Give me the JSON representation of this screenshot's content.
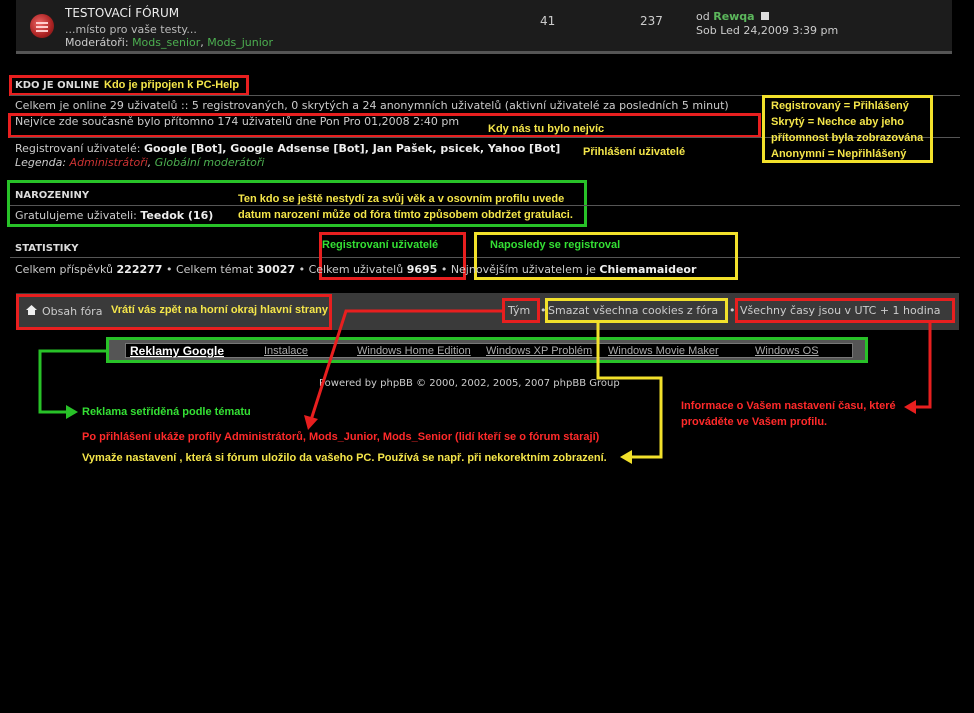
{
  "forum": {
    "title": "TESTOVACÍ FÓRUM",
    "description": "...místo pro vaše testy...",
    "moderators_label": "Moderátoři:",
    "moderator1": "Mods_senior",
    "separator": ",",
    "moderator2": "Mods_junior",
    "topics": "41",
    "posts": "237",
    "last_post_prefix": "od",
    "last_post_user": "Rewqa",
    "last_post_date": "Sob Led 24,2009 3:39 pm"
  },
  "online": {
    "header": "KDO JE ONLINE",
    "total_line": "Celkem je online 29 uživatelů :: 5 registrovaných, 0 skrytých a 24 anonymních uživatelů (aktivní uživatelé za posledních 5 minut)",
    "max_line": "Nejvíce zde současně bylo přítomno 174 uživatelů dne Pon Pro 01,2008 2:40 pm",
    "registered_prefix": "Registrovaní uživatelé:",
    "registered_users": "Google [Bot], Google Adsense [Bot], Jan Pašek, psicek, Yahoo [Bot]",
    "legend_label": "Legenda:",
    "legend_admins": "Administrátoři",
    "legend_mods": "Globální moderátoři"
  },
  "birthdays": {
    "header": "NAROZENINY",
    "line_prefix": "Gratulujeme uživateli:",
    "user": "Teedok (16)"
  },
  "stats": {
    "header": "STATISTIKY",
    "posts_label": "Celkem příspěvků",
    "posts": "222277",
    "topics_label": "Celkem témat",
    "topics": "30027",
    "users_label": "Celkem uživatelů",
    "users": "9695",
    "newest_label": "Nejnovějším uživatelem je",
    "newest": "Chiemamaideor",
    "bullet": "•"
  },
  "navbar": {
    "home": "Obsah fóra",
    "team": "Tým",
    "cookies": "Smazat všechna cookies z fóra",
    "timezone": "Všechny časy jsou v UTC + 1 hodina"
  },
  "ads": {
    "title": "Reklamy Google",
    "links": [
      "Instalace",
      "Windows Home Edition",
      "Windows XP Problém",
      "Windows Movie Maker",
      "Windows OS"
    ]
  },
  "footer": "Powered by phpBB © 2000, 2002, 2005, 2007 phpBB Group",
  "notes": {
    "online": "Kdo je připojen k PC-Help",
    "legend_l1": "Registrovaný = Přihlášený",
    "legend_l2": "Skrytý = Nechce aby jeho",
    "legend_l3": "přítomnost byla zobrazována",
    "legend_l4": "Anonymní = Nepřihlášený",
    "max": "Kdy nás tu bylo nejvíc",
    "logged": "Přihlášení uživatelé",
    "birthday_l1": "Ten kdo se ještě nestydí za svůj věk a v osovním profilu uvede",
    "birthday_l2": "datum narození může od fóra tímto způsobem obdržet gratulaci.",
    "registered": "Registrovaní uživatelé",
    "newest": "Naposledy se registroval",
    "home": "Vrátí vás zpět na horní okraj hlavní strany",
    "ads": "Reklama setříděná podle tématu",
    "team": "Po přihlášení ukáže profily Administrátorů, Mods_Junior, Mods_Senior (lidí kteří se o fórum starají)",
    "cookies": "Vymaže nastavení , která si fórum uložilo da vašeho PC. Používá se např. při nekorektním zobrazení.",
    "tz_l1": "Informace o Vašem nastavení času, které",
    "tz_l2": "prováděte ve Vašem profilu."
  },
  "colors": {
    "red_box": "#e81f1f",
    "green_box": "#28c228",
    "yellow_box": "#f2e12b",
    "admin": "#c33",
    "global_mod": "#4caf50"
  }
}
